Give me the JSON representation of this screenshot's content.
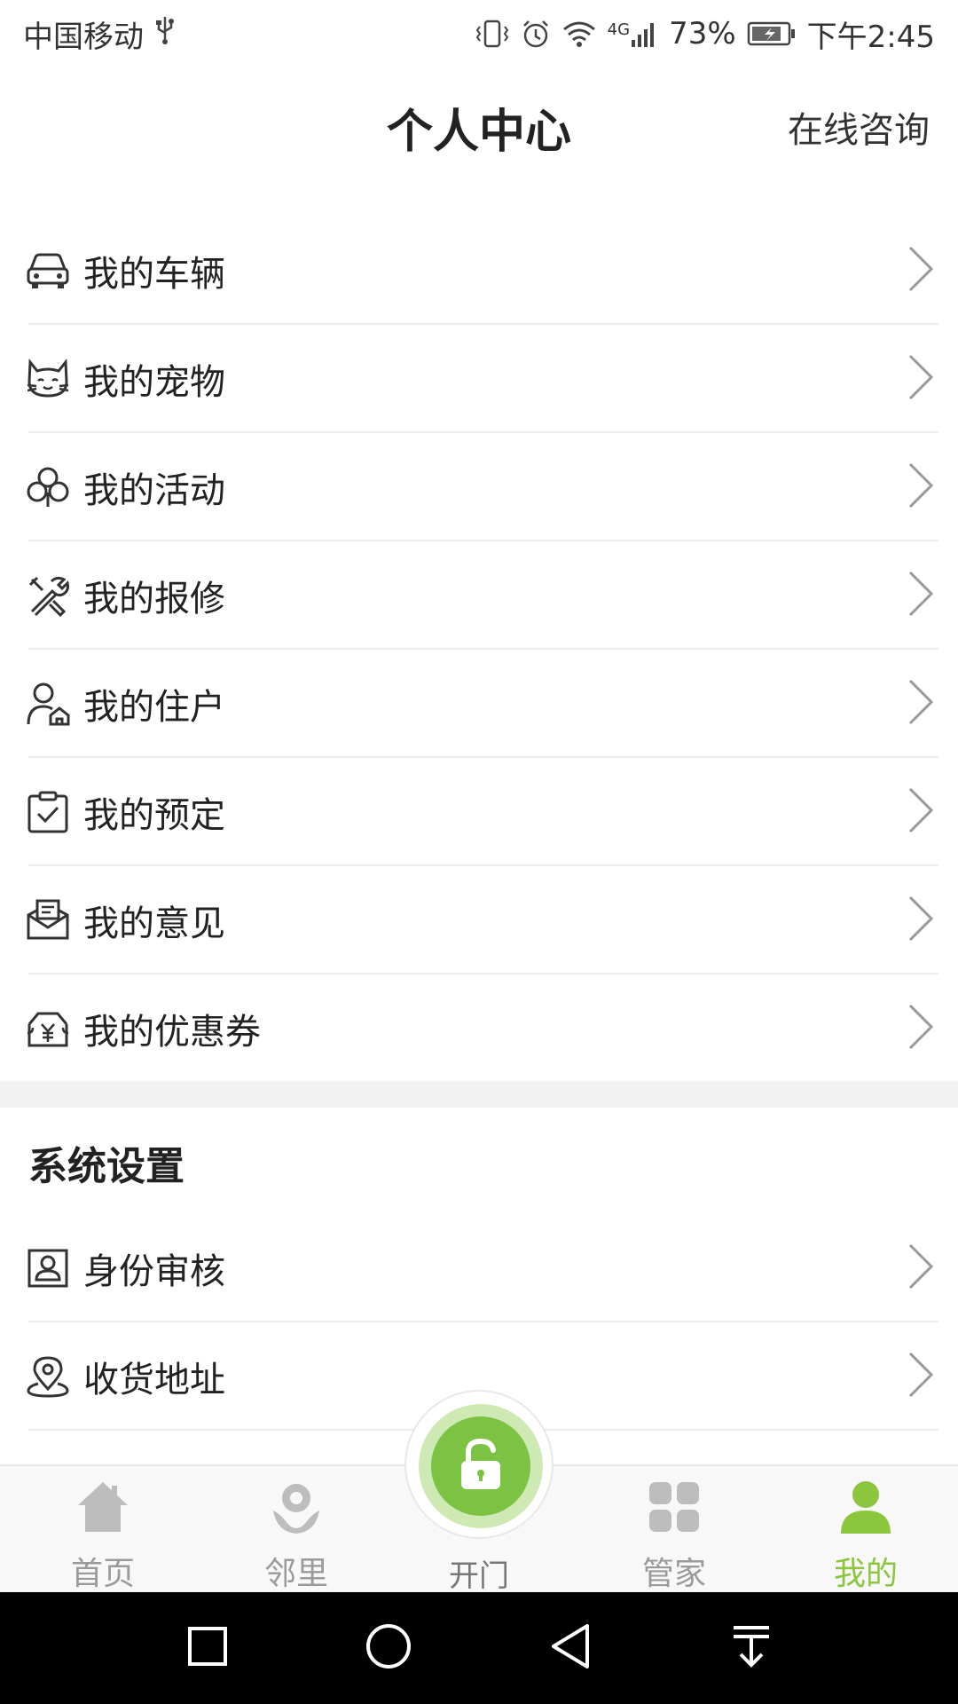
{
  "status_bar": {
    "carrier": "中国移动",
    "network": "4G",
    "battery": "73%",
    "time": "下午2:45"
  },
  "header": {
    "title": "个人中心",
    "consult_label": "在线咨询"
  },
  "menu": [
    {
      "label": "我的车辆",
      "icon": "car-icon"
    },
    {
      "label": "我的宠物",
      "icon": "pet-icon"
    },
    {
      "label": "我的活动",
      "icon": "activity-icon"
    },
    {
      "label": "我的报修",
      "icon": "repair-icon"
    },
    {
      "label": "我的住户",
      "icon": "resident-icon"
    },
    {
      "label": "我的预定",
      "icon": "booking-icon"
    },
    {
      "label": "我的意见",
      "icon": "feedback-icon"
    },
    {
      "label": "我的优惠券",
      "icon": "coupon-icon"
    }
  ],
  "settings": {
    "title": "系统设置",
    "items": [
      {
        "label": "身份审核",
        "icon": "id-card-icon"
      },
      {
        "label": "收货地址",
        "icon": "location-icon"
      }
    ]
  },
  "tabs": [
    {
      "label": "首页",
      "icon": "home-icon"
    },
    {
      "label": "邻里",
      "icon": "neighbor-icon"
    },
    {
      "label": "开门",
      "icon": "unlock-icon"
    },
    {
      "label": "管家",
      "icon": "grid-icon"
    },
    {
      "label": "我的",
      "icon": "user-icon"
    }
  ],
  "colors": {
    "accent": "#8cc63f",
    "open_button": "#7cc243",
    "tab_inactive": "#9a9a9a"
  }
}
